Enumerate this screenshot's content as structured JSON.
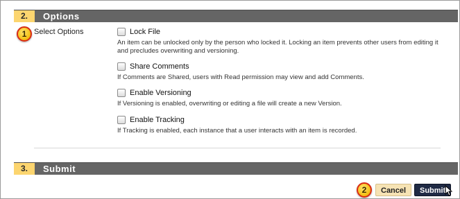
{
  "sections": [
    {
      "number": "2.",
      "title": "Options"
    },
    {
      "number": "3.",
      "title": "Submit"
    }
  ],
  "callouts": [
    "1",
    "2"
  ],
  "options_label": "Select Options",
  "options": [
    {
      "label": "Lock File",
      "description": "An item can be unlocked only by the person who locked it. Locking an item prevents other users from editing it and precludes overwriting and versioning.",
      "checked": false
    },
    {
      "label": "Share Comments",
      "description": "If Comments are Shared, users with Read permission may view and add Comments.",
      "checked": false
    },
    {
      "label": "Enable Versioning",
      "description": "If Versioning is enabled, overwriting or editing a file will create a new Version.",
      "checked": false
    },
    {
      "label": "Enable Tracking",
      "description": "If Tracking is enabled, each instance that a user interacts with an item is recorded.",
      "checked": false
    }
  ],
  "buttons": {
    "cancel": "Cancel",
    "submit": "Submit"
  },
  "colors": {
    "section_bar": "#656565",
    "section_number_bg": "#fcd56f",
    "callout_fill": "#f5c21c",
    "callout_border": "#d92a14",
    "submit_bg": "#1f2a44",
    "cancel_bg": "#f6e3b4"
  }
}
